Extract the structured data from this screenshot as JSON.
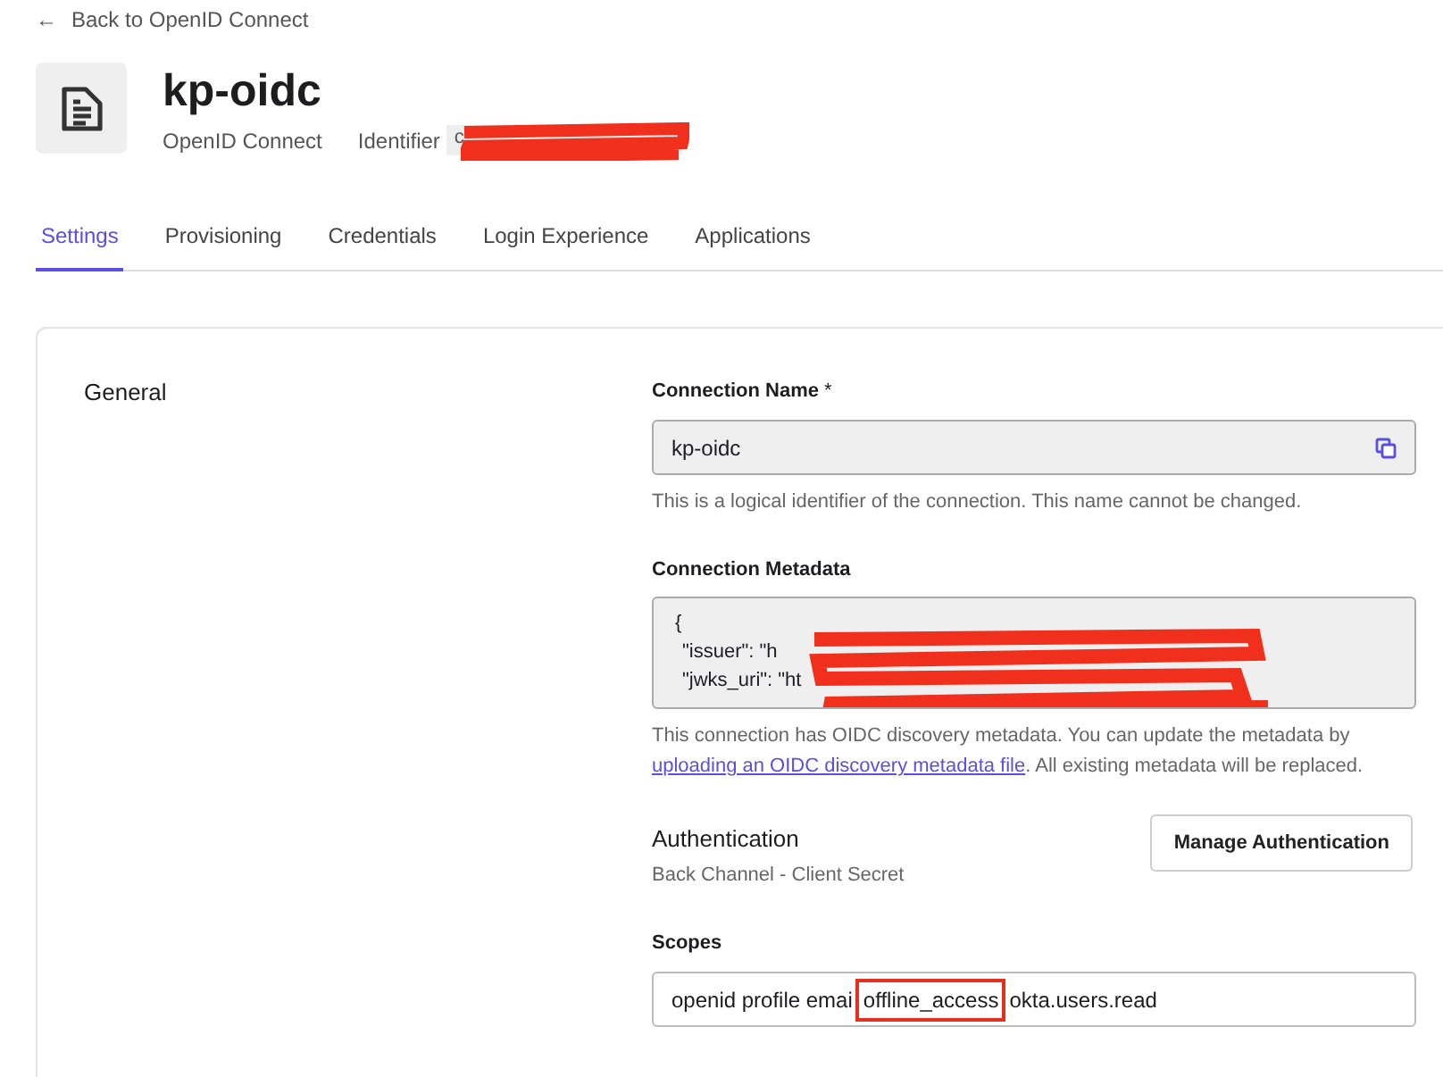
{
  "back_link": {
    "arrow": "←",
    "label": "Back to OpenID Connect"
  },
  "header": {
    "title": "kp-oidc",
    "type": "OpenID Connect",
    "identifier_label": "Identifier",
    "identifier_value": "c",
    "identifier_redacted": true
  },
  "tabs": [
    {
      "label": "Settings",
      "selected": true
    },
    {
      "label": "Provisioning",
      "selected": false
    },
    {
      "label": "Credentials",
      "selected": false
    },
    {
      "label": "Login Experience",
      "selected": false
    },
    {
      "label": "Applications",
      "selected": false
    }
  ],
  "section": {
    "title": "General",
    "connection_name": {
      "label": "Connection Name",
      "required_mark": "*",
      "value": "kp-oidc",
      "help": "This is a logical identifier of the connection. This name cannot be changed."
    },
    "metadata": {
      "label": "Connection Metadata",
      "lines": [
        "{",
        "\"issuer\": \"h",
        "\"jwks_uri\": \"ht"
      ],
      "redacted": true,
      "help_before": "This connection has OIDC discovery metadata. You can update the metadata by ",
      "help_link": "uploading an OIDC discovery metadata file",
      "help_after": ". All existing metadata will be replaced."
    },
    "authentication": {
      "title": "Authentication",
      "subtitle": "Back Channel - Client Secret",
      "button": "Manage Authentication"
    },
    "scopes": {
      "label": "Scopes",
      "value_before": "openid profile emai",
      "highlighted": "offline_access",
      "value_after": "okta.users.read"
    }
  }
}
